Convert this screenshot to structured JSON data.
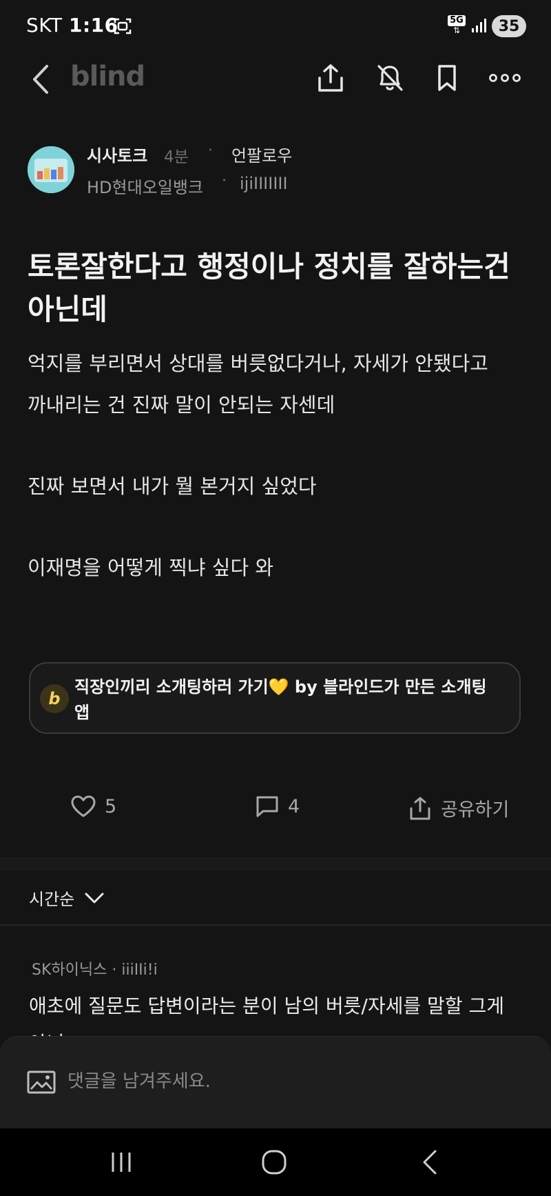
{
  "status_bar": {
    "carrier": "SKT",
    "time": "1:16",
    "network": "5G",
    "battery": "35"
  },
  "nav": {
    "logo": "blind",
    "icons": [
      "back-icon",
      "share-icon",
      "bell-off-icon",
      "bookmark-icon",
      "more-icon"
    ]
  },
  "author": {
    "channel": "시사토크",
    "time_ago": "4분",
    "separator": "·",
    "unfollow_label": "언팔로우",
    "company": "HD현대오일뱅크",
    "nickname": "ijiIIIIIII"
  },
  "post": {
    "title": "토론잘한다고 행정이나 정치를 잘하는건 아닌데",
    "lines": [
      "억지를 부리면서 상대를 버릇없다거나, 자세가 안됐다고",
      "까내리는 건 진짜 말이 안되는 자센데",
      "진짜 보면서 내가 뭘 본거지 싶었다",
      "이재명을 어떻게 찍냐 싶다 와"
    ]
  },
  "ad": {
    "logo_letter": "b",
    "text": "직장인끼리 소개팅하러 가기💛 by 블라인드가 만든 소개팅앱"
  },
  "actions": {
    "likes": "5",
    "comments": "4",
    "share_label": "공유하기"
  },
  "sort": {
    "label": "시간순"
  },
  "comment": {
    "company": "SK하이닉스",
    "separator": "·",
    "nickname": "iiiIIi!i",
    "text": "애초에 질문도 답변이라는 분이 남의 버릇/자세를 말할 그게 아닌 ㅋㅋㅋ"
  },
  "composer": {
    "placeholder": "댓글을 남겨주세요."
  },
  "colors": {
    "background": "#141414",
    "panel": "#1e1e1e",
    "muted_text": "#9a9a9a",
    "ad_accent": "#f1d260"
  }
}
